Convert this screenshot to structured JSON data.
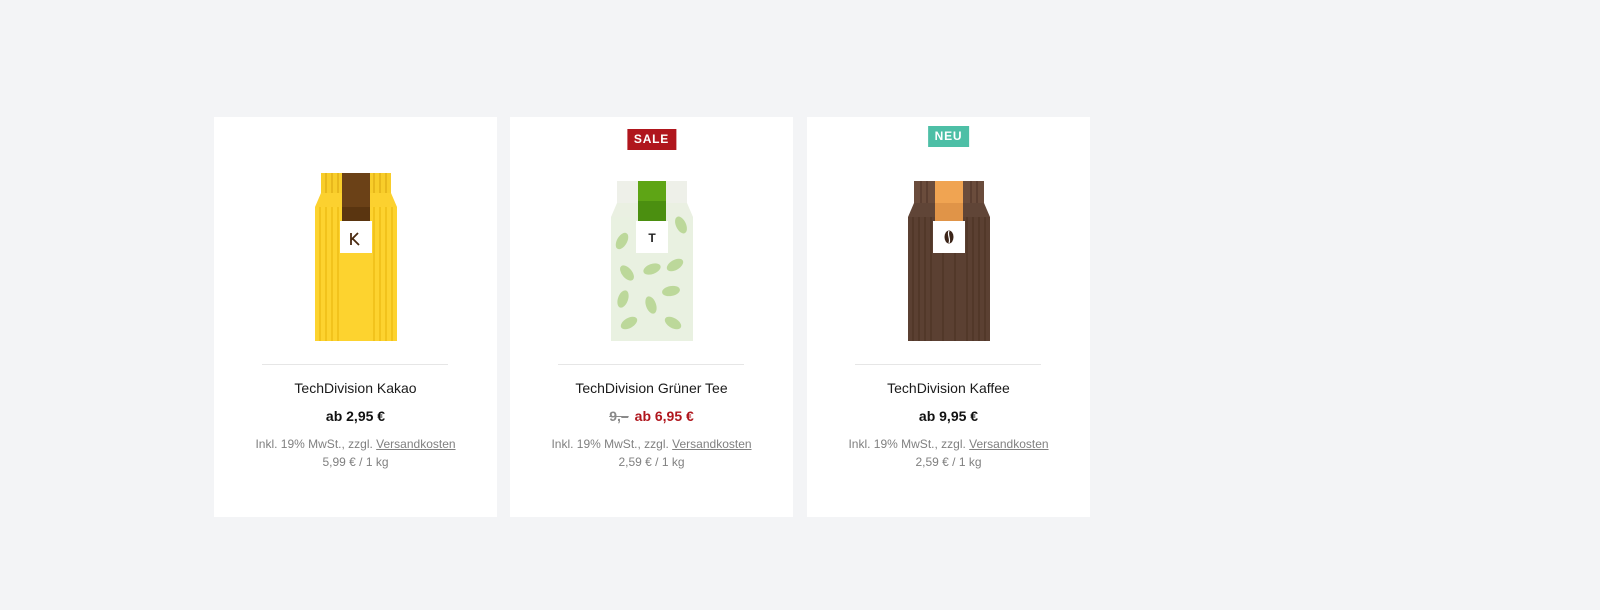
{
  "products": [
    {
      "name": "TechDivision Kakao",
      "price": "ab 2,95 €",
      "tax_prefix": "Inkl. 19% MwSt., zzgl. ",
      "shipping_link": "Versandkosten",
      "unit_price": "5,99 € / 1 kg",
      "label_symbol": "K",
      "image_icon": "cocoa-package-icon"
    },
    {
      "name": "TechDivision Grüner Tee",
      "badge": "SALE",
      "old_price": "9,–",
      "price": "ab 6,95  €",
      "tax_prefix": "Inkl. 19% MwSt., zzgl. ",
      "shipping_link": "Versandkosten",
      "unit_price": "2,59 € / 1 kg",
      "label_symbol": "T",
      "image_icon": "green-tea-package-icon"
    },
    {
      "name": "TechDivision Kaffee",
      "badge": "NEU",
      "price": "ab 9,95 €",
      "tax_prefix": "Inkl. 19% MwSt., zzgl. ",
      "shipping_link": "Versandkosten",
      "unit_price": "2,59 € / 1 kg",
      "label_symbol": "coffee-bean",
      "image_icon": "coffee-package-icon"
    }
  ],
  "colors": {
    "page_background": "#f3f4f6",
    "card_background": "#ffffff",
    "sale_badge": "#b0161d",
    "new_badge": "#4dbfa6",
    "sale_price": "#b0161d"
  }
}
